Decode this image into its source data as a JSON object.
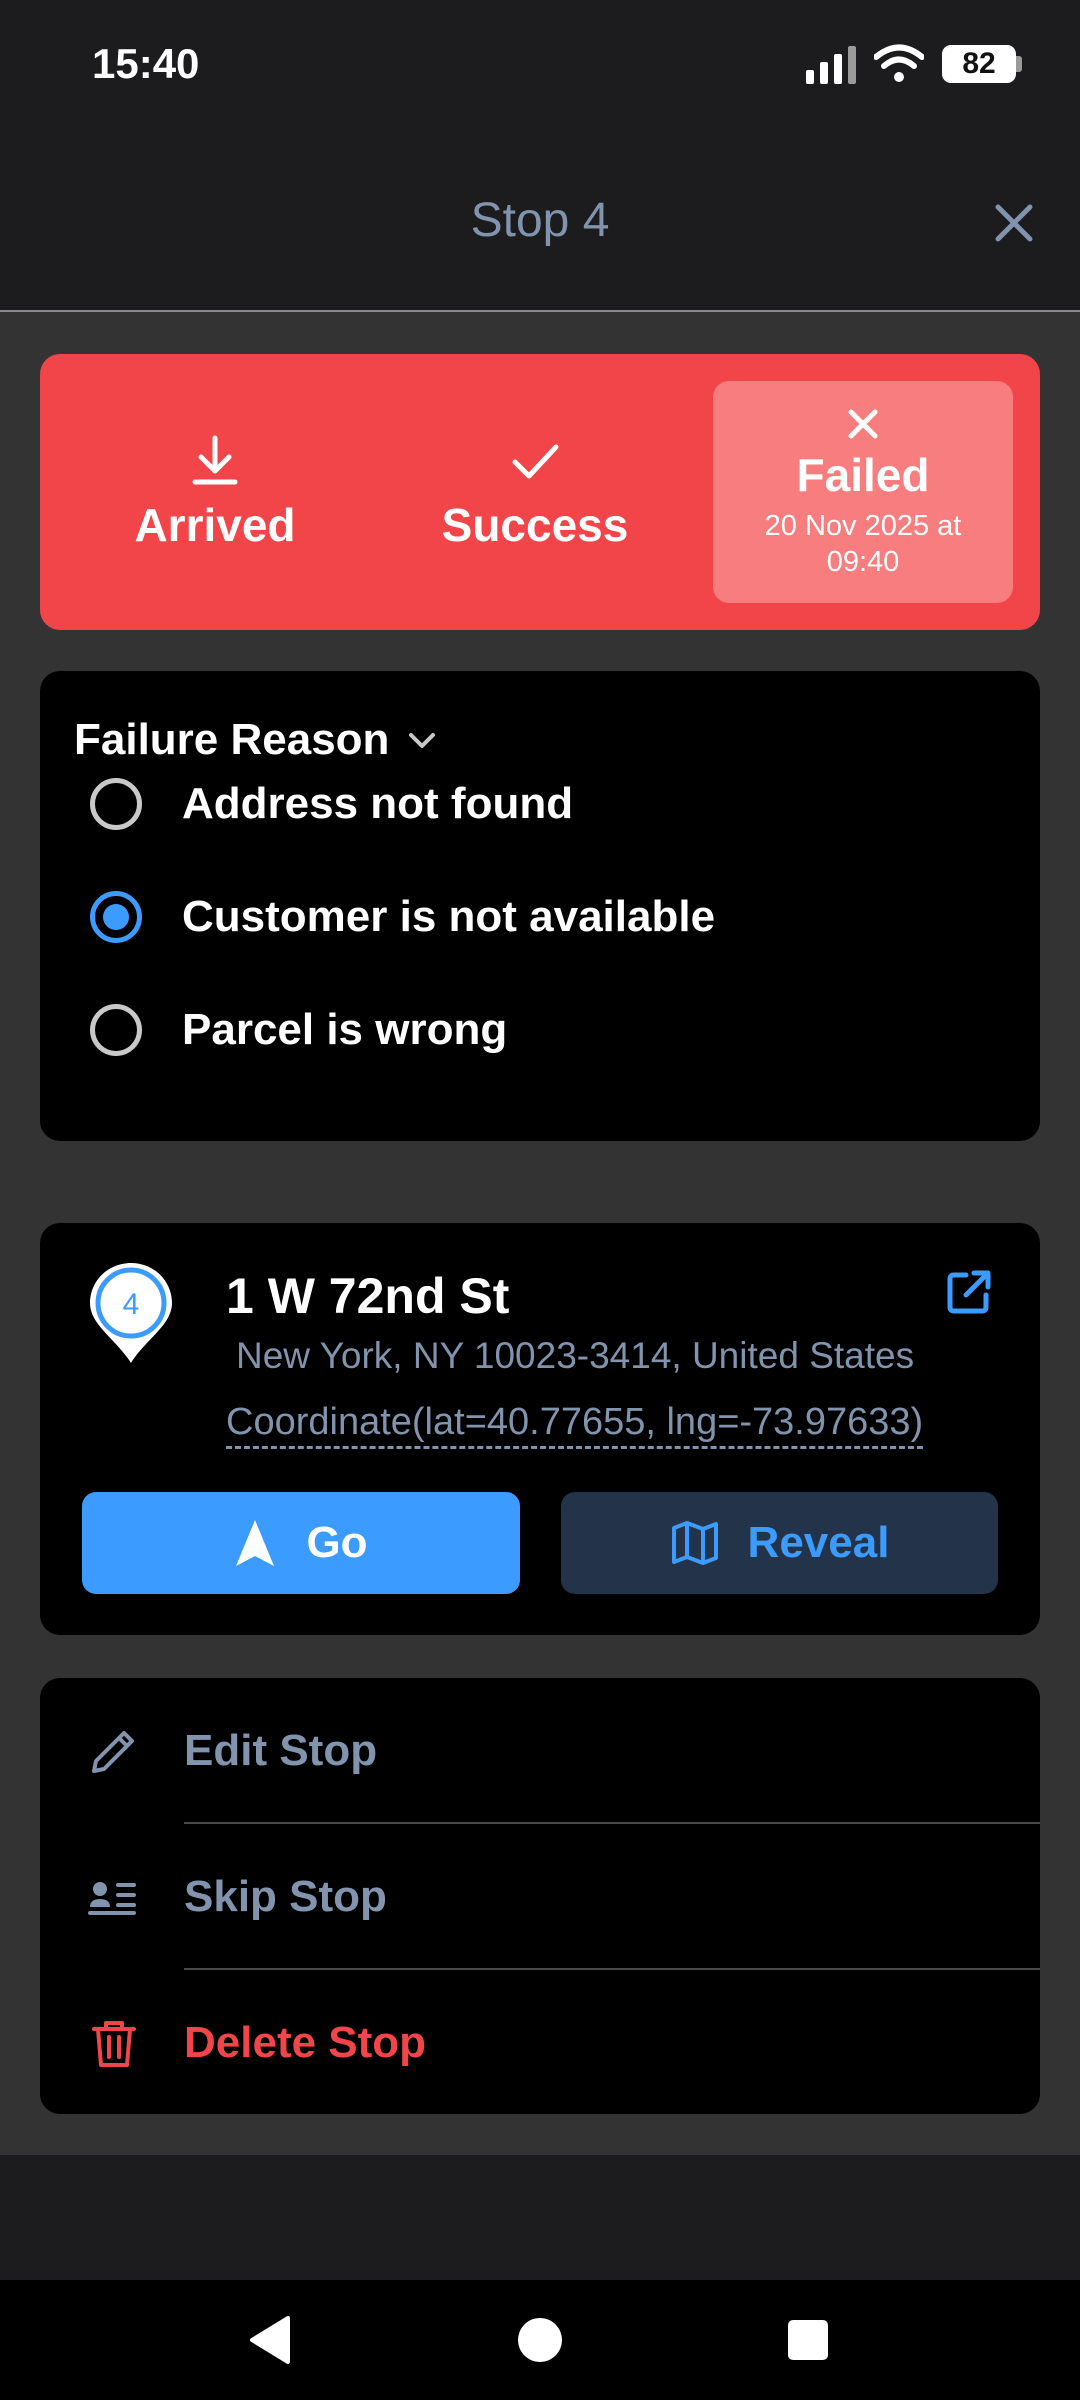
{
  "status_bar": {
    "time": "15:40",
    "battery": "82"
  },
  "sheet": {
    "title": "Stop 4"
  },
  "stop_status": {
    "options": [
      {
        "label": "Arrived"
      },
      {
        "label": "Success"
      },
      {
        "label": "Failed",
        "date": "20 Nov 2025 at 09:40",
        "selected": true
      }
    ]
  },
  "failure": {
    "title": "Failure Reason",
    "reasons": [
      {
        "label": "Address not found",
        "selected": false
      },
      {
        "label": "Customer is not available",
        "selected": true
      },
      {
        "label": "Parcel is wrong",
        "selected": false
      }
    ]
  },
  "address": {
    "pin_number": "4",
    "title": "1 W 72nd St",
    "subtitle": "New York, NY 10023-3414, United States",
    "coordinate": "Coordinate(lat=40.77655, lng=-73.97633)",
    "go_label": "Go",
    "reveal_label": "Reveal"
  },
  "actions": {
    "edit": "Edit Stop",
    "skip": "Skip Stop",
    "delete": "Delete Stop"
  },
  "colors": {
    "accent": "#3b9bff",
    "danger": "#f24549",
    "muted": "#8193ad"
  }
}
